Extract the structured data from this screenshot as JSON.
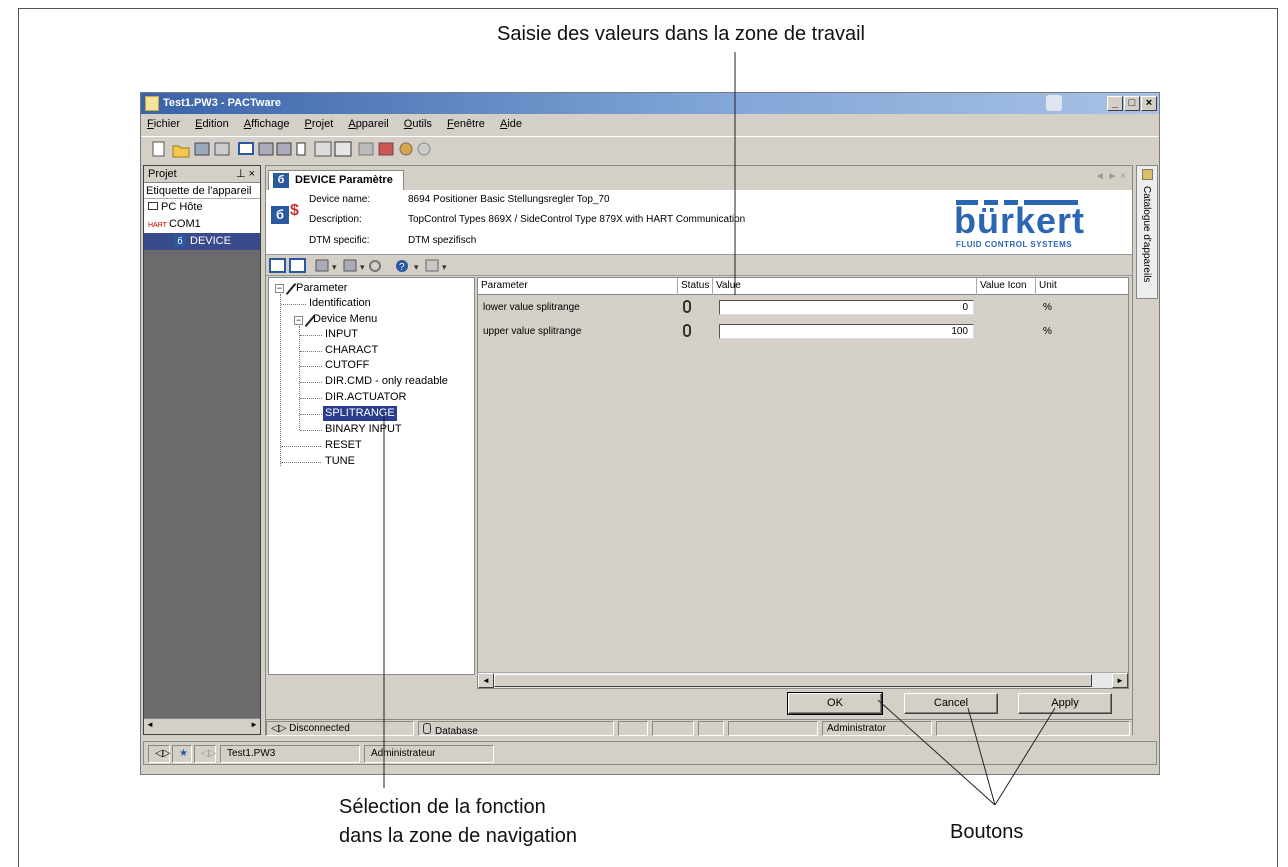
{
  "window": {
    "title": "Test1.PW3 - PACTware"
  },
  "menu": [
    "Fichier",
    "Edition",
    "Affichage",
    "Projet",
    "Appareil",
    "Outils",
    "Fenêtre",
    "Aide"
  ],
  "project_panel": {
    "title": "Projet",
    "pin_close": " # ×",
    "column_header": "Etiquette de l'appareil",
    "tree": [
      {
        "label": "PC Hôte",
        "icon": "computer-icon"
      },
      {
        "label": "COM1",
        "icon": "hart-com-icon",
        "prefix": "HART"
      },
      {
        "label": "DEVICE",
        "icon": "device-icon",
        "selected": true
      }
    ]
  },
  "catalogue_tab": "Catalogue d'appareils",
  "document": {
    "tab_title": "DEVICE Paramètre",
    "header": {
      "device_name_label": "Device name:",
      "device_name_value": "8694 Positioner Basic Stellungsregler Top_70",
      "description_label": "Description:",
      "description_value": "TopControl Types 869X / SideControl Type 879X  with HART Communication",
      "dtm_label": "DTM specific:",
      "dtm_value": "DTM spezifisch",
      "logo_word": "bürkert",
      "logo_sub": "FLUID CONTROL SYSTEMS"
    },
    "nav_tree": {
      "root": "Parameter",
      "identification": "Identification",
      "device_menu": "Device Menu",
      "items": [
        "INPUT",
        "CHARACT",
        "CUTOFF",
        "DIR.CMD - only readable",
        "DIR.ACTUATOR",
        "SPLITRANGE",
        "BINARY INPUT"
      ],
      "selected": "SPLITRANGE",
      "reset": "RESET",
      "tune": "TUNE"
    },
    "grid": {
      "headers": [
        "Parameter",
        "Status",
        "Value",
        "Value Icon",
        "Unit"
      ],
      "rows": [
        {
          "parameter": "lower value splitrange",
          "value": "0",
          "unit": "%"
        },
        {
          "parameter": "upper value splitrange",
          "value": "100",
          "unit": "%"
        }
      ]
    },
    "buttons": {
      "ok": "OK",
      "cancel": "Cancel",
      "apply": "Apply"
    },
    "status": {
      "connection": "Disconnected",
      "database": "Database",
      "user": "Administrator"
    }
  },
  "app_status": {
    "file": "Test1.PW3",
    "user": "Administrateur"
  },
  "annotations": {
    "top": "Saisie des valeurs dans la zone de travail",
    "bottom_line1": "Sélection de la fonction",
    "bottom_line2": "dans la zone de navigation",
    "buttons": "Boutons"
  },
  "colors": {
    "title_gradient_start": "#3a62a8",
    "selection": "#2a3d8f",
    "brand_blue": "#2b66b3",
    "window_face": "#d4d0c8"
  }
}
